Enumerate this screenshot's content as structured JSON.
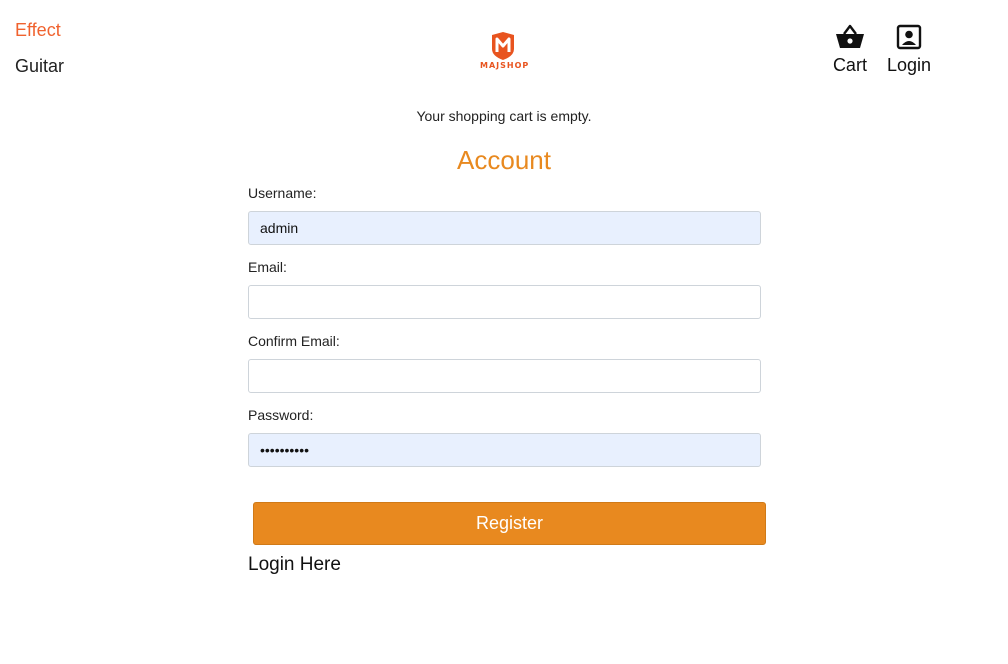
{
  "nav": {
    "left_links": [
      "Effect",
      "Guitar"
    ],
    "logo_text": "MAJSHOP",
    "cart_label": "Cart",
    "login_label": "Login"
  },
  "cart": {
    "message": "Your shopping cart is empty."
  },
  "form": {
    "title": "Account",
    "username_label": "Username:",
    "username_value": "admin",
    "email_label": "Email:",
    "email_value": "",
    "confirm_email_label": "Confirm Email:",
    "confirm_email_value": "",
    "password_label": "Password:",
    "password_value": "••••••••••",
    "register_label": "Register",
    "login_link": "Login Here"
  },
  "colors": {
    "accent": "#e8891f",
    "active_link": "#f0622e",
    "autofill": "#e8f0fe"
  }
}
